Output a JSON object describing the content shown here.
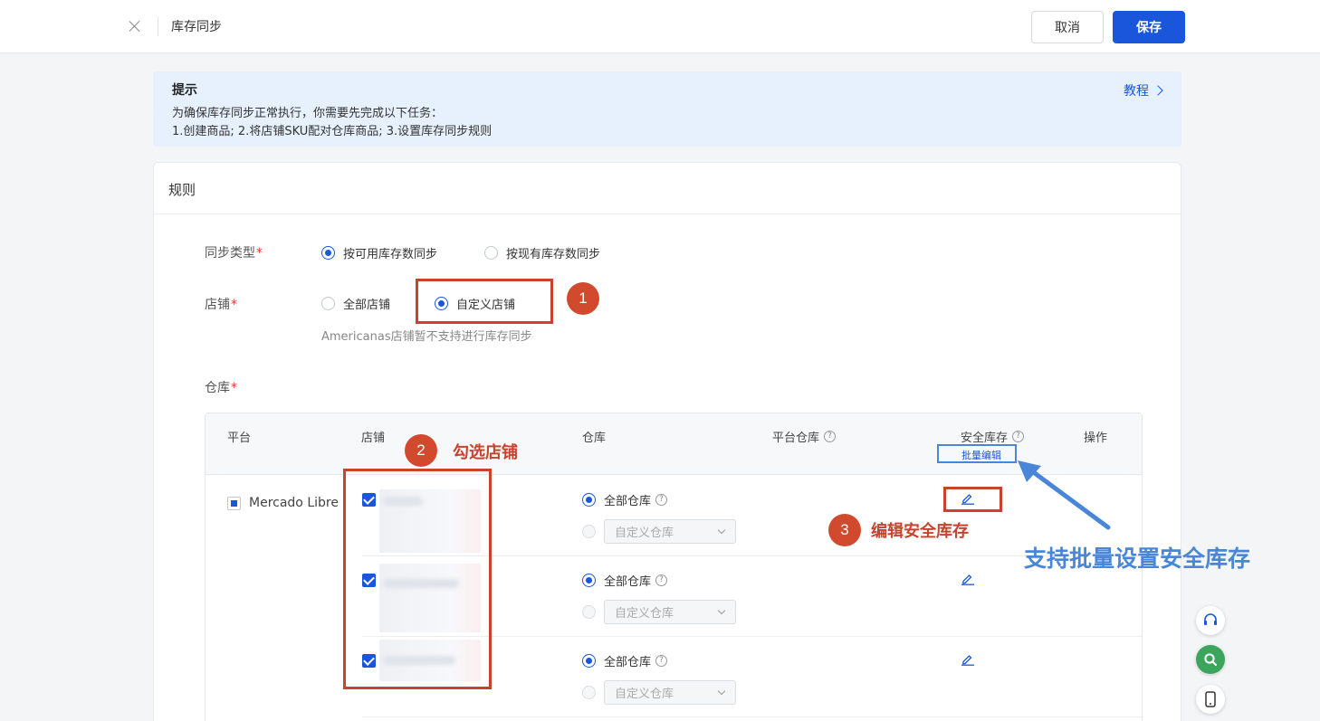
{
  "header": {
    "title": "库存同步",
    "cancel_label": "取消",
    "save_label": "保存"
  },
  "tip": {
    "title": "提示",
    "line1": "为确保库存同步正常执行，你需要先完成以下任务：",
    "line2": "1.创建商品;   2.将店铺SKU配对仓库商品;   3.设置库存同步规则",
    "tutorial_label": "教程"
  },
  "rules": {
    "title": "规则",
    "sync_type": {
      "label": "同步类型",
      "options": [
        "按可用库存数同步",
        "按现有库存数同步"
      ],
      "selected": "按可用库存数同步"
    },
    "store": {
      "label": "店铺",
      "options": [
        "全部店铺",
        "自定义店铺"
      ],
      "selected": "自定义店铺",
      "hint": "Americanas店铺暂不支持进行库存同步"
    },
    "warehouse": {
      "label": "仓库",
      "columns": {
        "platform": "平台",
        "store": "店铺",
        "warehouse": "仓库",
        "platform_warehouse": "平台仓库",
        "safety_stock": "安全库存",
        "batch_edit": "批量编辑",
        "action": "操作"
      },
      "platform": "Mercado Libre",
      "rows": [
        {
          "store_checked": true,
          "warehouse_option_all": "全部仓库",
          "warehouse_option_custom": "自定义仓库",
          "warehouse_selected": "全部仓库"
        },
        {
          "store_checked": true,
          "warehouse_option_all": "全部仓库",
          "warehouse_option_custom": "自定义仓库",
          "warehouse_selected": "全部仓库"
        },
        {
          "store_checked": true,
          "warehouse_option_all": "全部仓库",
          "warehouse_option_custom": "自定义仓库",
          "warehouse_selected": "全部仓库"
        }
      ]
    }
  },
  "annotations": {
    "step1": "1",
    "step2": "2",
    "step2_text": "勾选店铺",
    "step3": "3",
    "step3_text": "编辑安全库存",
    "batch_text": "支持批量设置安全库存",
    "red": "#c8432e",
    "blue": "#4a86d8"
  },
  "colors": {
    "primary": "#1a56db",
    "tip_bg": "#e6f1fd",
    "required": "#e33333",
    "float_green": "#3ca55c"
  },
  "icons": [
    "close-icon",
    "chevron-right-icon",
    "question-icon",
    "chevron-down-icon",
    "edit-icon",
    "headset-icon",
    "search-icon",
    "mobile-icon"
  ]
}
